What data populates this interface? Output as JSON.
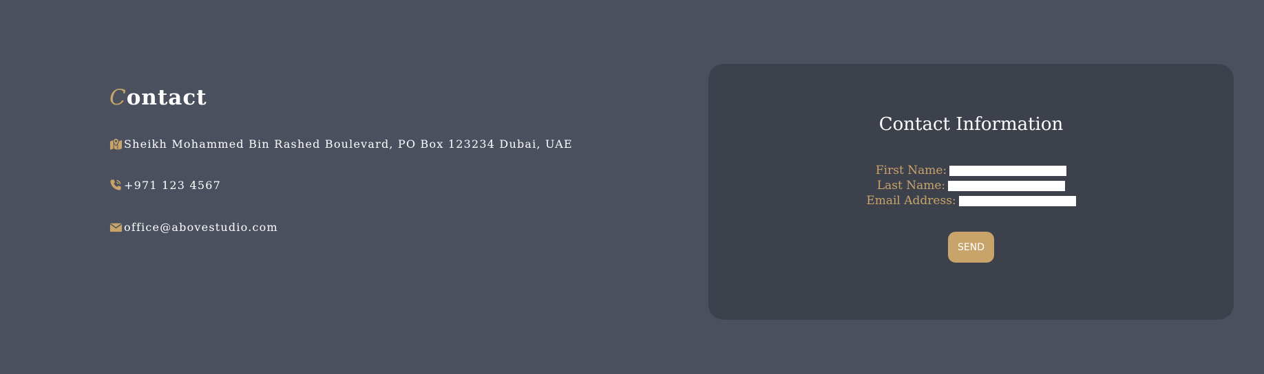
{
  "contact": {
    "title_initial": "C",
    "title_rest": "ontact",
    "address": "Sheikh Mohammed Bin Rashed Boulevard, PO Box 123234 Dubai, UAE",
    "phone": "+971 123 4567",
    "email": "office@abovestudio.com",
    "icons": {
      "address": "map-marker-icon",
      "phone": "phone-volume-icon",
      "email": "envelope-icon"
    }
  },
  "form": {
    "title": "Contact Information",
    "first_name_label": "First Name:",
    "last_name_label": "Last Name:",
    "email_label": "Email Address:",
    "first_name_value": "",
    "last_name_value": "",
    "email_value": "",
    "send_label": "SEND"
  },
  "colors": {
    "page_background": "#4a505d",
    "card_background": "#3d414b",
    "accent": "#c8a46b",
    "text": "#ffffff"
  }
}
